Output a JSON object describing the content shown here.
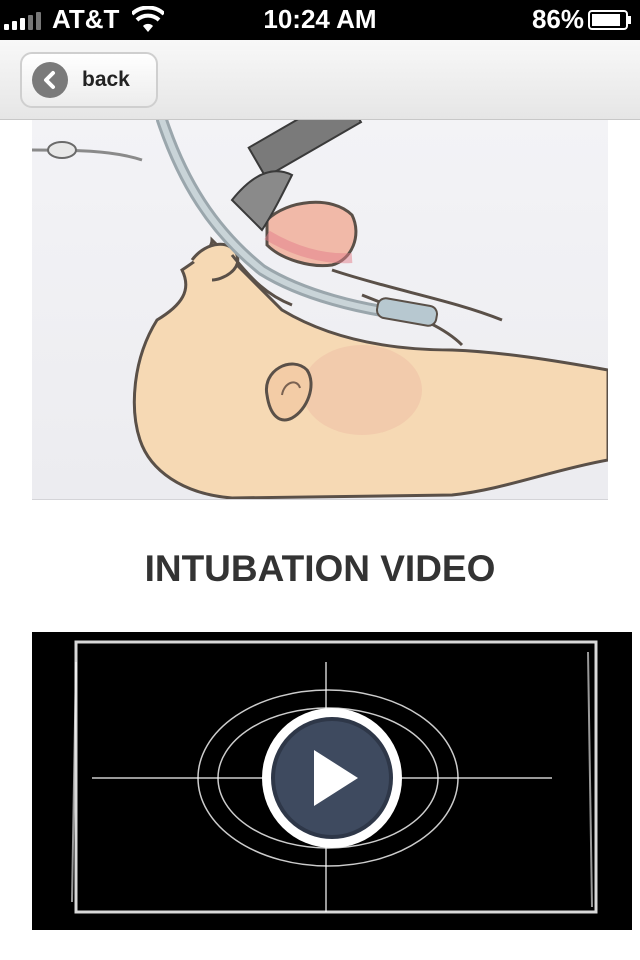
{
  "status_bar": {
    "carrier": "AT&T",
    "time": "10:24 AM",
    "battery_percent": "86%",
    "battery_level": 0.86
  },
  "nav": {
    "back_label": "back"
  },
  "content": {
    "section_title": "INTUBATION VIDEO"
  },
  "icons": {
    "back": "chevron-left-icon",
    "play": "play-icon",
    "wifi": "wifi-icon",
    "battery": "battery-icon",
    "signal": "signal-icon"
  }
}
